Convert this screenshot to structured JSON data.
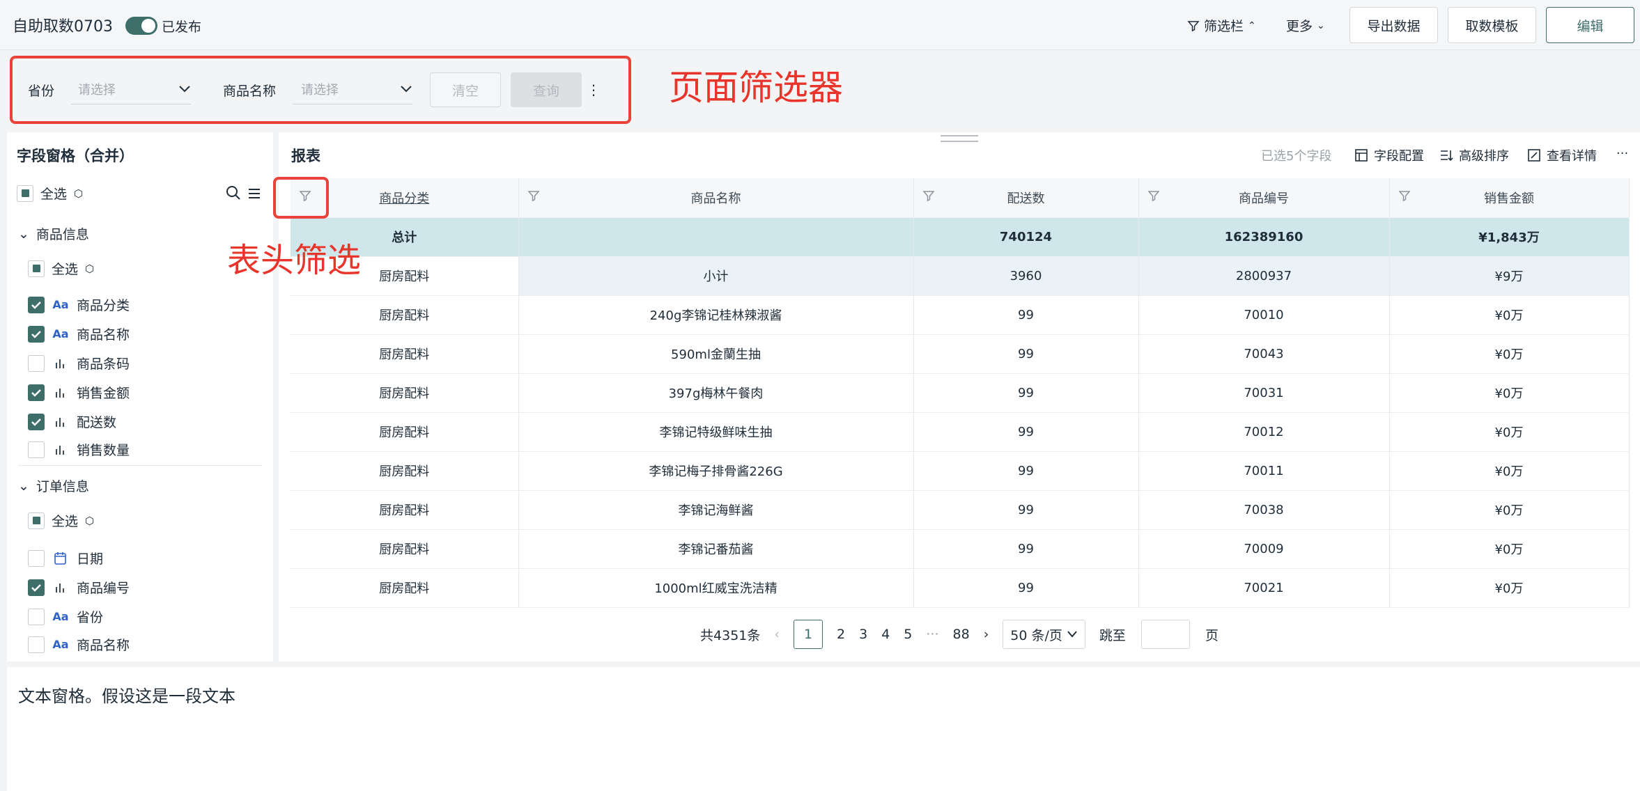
{
  "header": {
    "title": "自助取数0703",
    "publish_label": "已发布",
    "filterbar_label": "筛选栏",
    "more_label": "更多",
    "export_label": "导出数据",
    "template_label": "取数模板",
    "edit_label": "编辑"
  },
  "filters": {
    "province_label": "省份",
    "province_placeholder": "请选择",
    "product_label": "商品名称",
    "product_placeholder": "请选择",
    "clear_label": "清空",
    "query_label": "查询",
    "menu_label": "⋮"
  },
  "annotations": {
    "page_filter": "页面筛选器",
    "header_filter": "表头筛选"
  },
  "field_pane": {
    "title": "字段窗格（合并）",
    "select_all": "全选",
    "groups": [
      {
        "name": "商品信息",
        "select_all": "全选",
        "fields": [
          {
            "label": "商品分类",
            "type": "text",
            "checked": true
          },
          {
            "label": "商品名称",
            "type": "text",
            "checked": true
          },
          {
            "label": "商品条码",
            "type": "measure",
            "checked": false
          },
          {
            "label": "销售金额",
            "type": "measure",
            "checked": true
          },
          {
            "label": "配送数",
            "type": "measure",
            "checked": true
          },
          {
            "label": "销售数量",
            "type": "measure",
            "checked": false
          }
        ]
      },
      {
        "name": "订单信息",
        "select_all": "全选",
        "fields": [
          {
            "label": "日期",
            "type": "date",
            "checked": false
          },
          {
            "label": "商品编号",
            "type": "measure",
            "checked": true
          },
          {
            "label": "省份",
            "type": "text",
            "checked": false
          },
          {
            "label": "商品名称",
            "type": "text",
            "checked": false
          }
        ]
      }
    ]
  },
  "report": {
    "title": "报表",
    "selected_count": "已选5个字段",
    "field_config": "字段配置",
    "advanced_sort": "高级排序",
    "view_details": "查看详情",
    "more": "···",
    "columns": [
      "商品分类",
      "商品名称",
      "配送数",
      "商品编号",
      "销售金额"
    ],
    "total_row": [
      "总计",
      "",
      "740124",
      "162389160",
      "¥1,843万"
    ],
    "rows": [
      [
        "厨房配料",
        "小计",
        "3960",
        "2800937",
        "¥9万"
      ],
      [
        "厨房配料",
        "240g李锦记桂林辣淑酱",
        "99",
        "70010",
        "¥0万"
      ],
      [
        "厨房配料",
        "590ml金蘭生抽",
        "99",
        "70043",
        "¥0万"
      ],
      [
        "厨房配料",
        "397g梅林午餐肉",
        "99",
        "70031",
        "¥0万"
      ],
      [
        "厨房配料",
        "李锦记特级鲜味生抽",
        "99",
        "70012",
        "¥0万"
      ],
      [
        "厨房配料",
        "李锦记梅子排骨酱226G",
        "99",
        "70011",
        "¥0万"
      ],
      [
        "厨房配料",
        "李锦记海鲜酱",
        "99",
        "70038",
        "¥0万"
      ],
      [
        "厨房配料",
        "李锦记番茄酱",
        "99",
        "70009",
        "¥0万"
      ],
      [
        "厨房配料",
        "1000ml红威宝洗洁精",
        "99",
        "70021",
        "¥0万"
      ]
    ],
    "pagination": {
      "total": "共4351条",
      "pages": [
        "1",
        "2",
        "3",
        "4",
        "5"
      ],
      "ellipsis": "···",
      "last_page": "88",
      "page_size": "50 条/页",
      "jump_label": "跳至",
      "page_suffix": "页"
    }
  },
  "text_pane": {
    "content": "文本窗格。假设这是一段文本"
  },
  "colors": {
    "accent": "#3d6e6a",
    "annotation_red": "#e8342a",
    "total_row_bg": "#cfe6ea"
  }
}
